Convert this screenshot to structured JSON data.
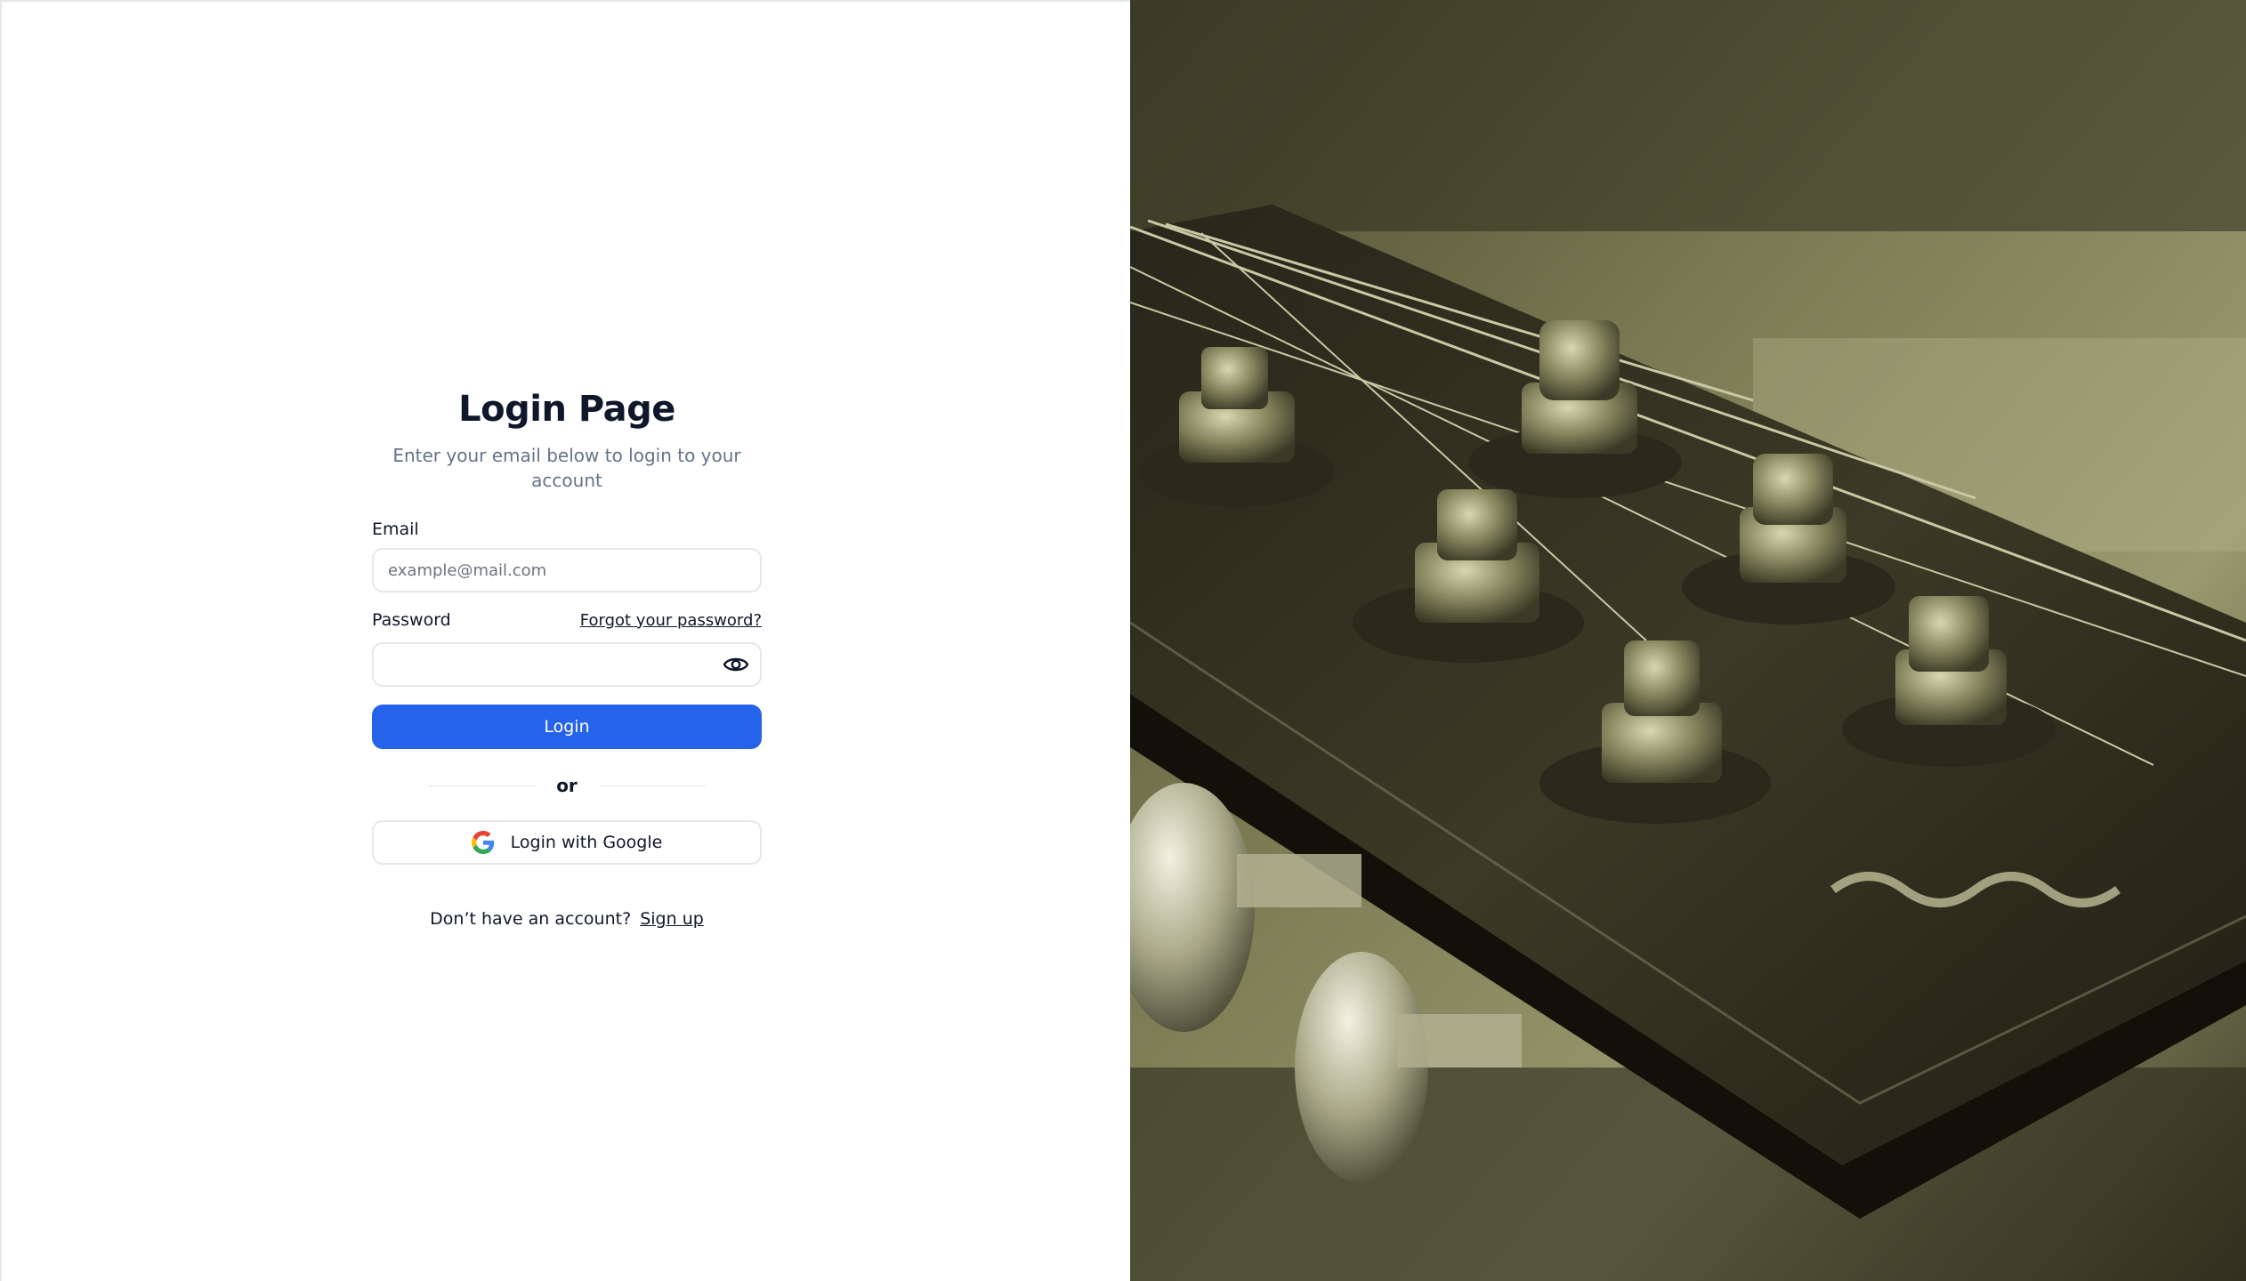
{
  "login": {
    "title": "Login Page",
    "subtitle": "Enter your email below to login to your account",
    "email_label": "Email",
    "email_placeholder": "example@mail.com",
    "email_value": "",
    "password_label": "Password",
    "forgot_link": "Forgot your password?",
    "password_value": "",
    "password_toggle_icon": "eye-icon",
    "login_button": "Login",
    "divider_text": "or",
    "google_button": "Login with Google",
    "google_icon": "google-icon",
    "signup_prompt": "Don’t have an account?",
    "signup_link": "Sign up"
  },
  "hero_image": {
    "description_icon": "guitar-headstock-image"
  },
  "colors": {
    "primary": "#2563eb",
    "text": "#0f172a",
    "muted": "#64748b",
    "border": "#e5e7eb",
    "image_tint": "#7a7a4a"
  }
}
